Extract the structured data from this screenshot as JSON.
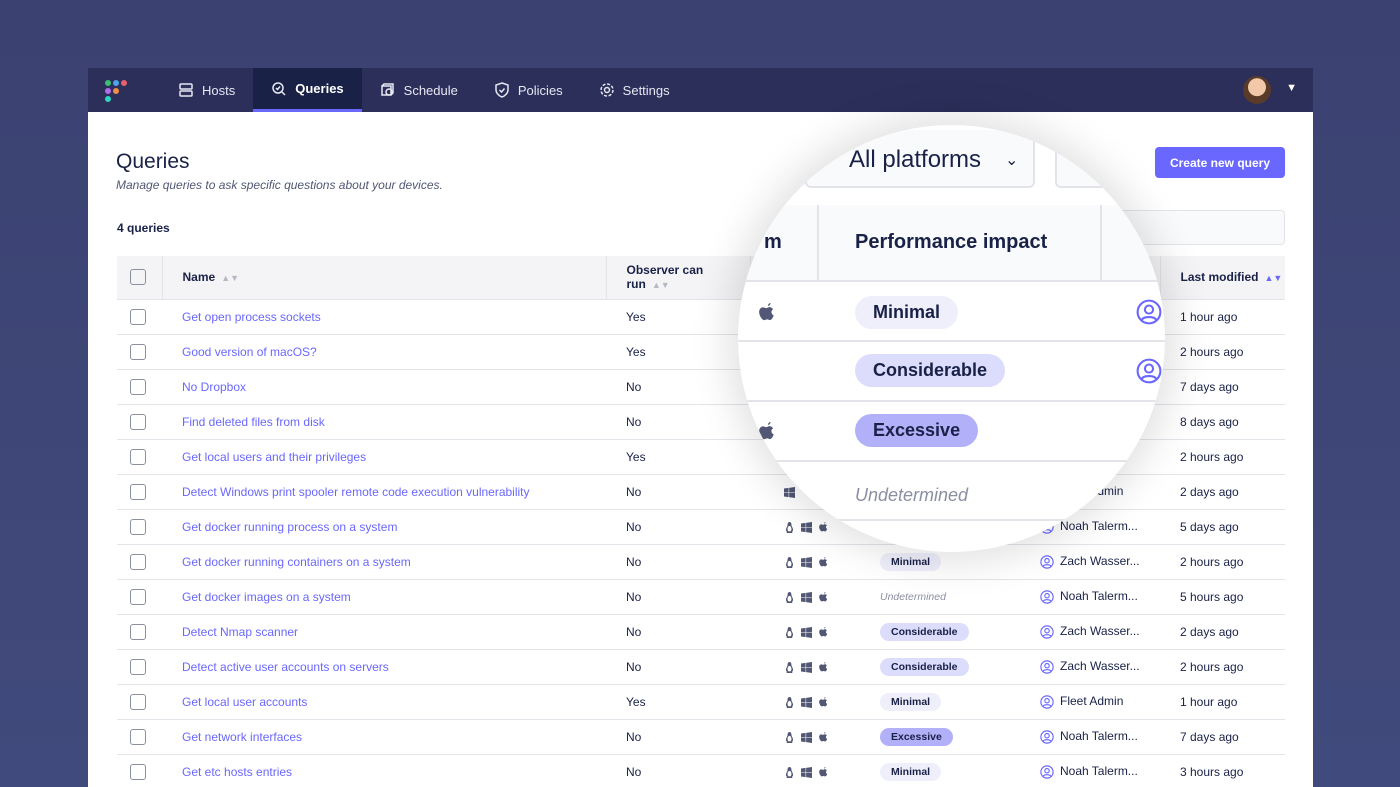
{
  "nav": {
    "tabs": [
      {
        "label": "Hosts",
        "icon": "hosts-icon"
      },
      {
        "label": "Queries",
        "icon": "queries-icon",
        "active": true
      },
      {
        "label": "Schedule",
        "icon": "schedule-icon"
      },
      {
        "label": "Policies",
        "icon": "policies-icon"
      },
      {
        "label": "Settings",
        "icon": "gear-icon"
      }
    ]
  },
  "page": {
    "title": "Queries",
    "subtitle": "Manage queries to ask specific questions about your devices.",
    "count": "4 queries",
    "create_label": "Create new query",
    "platform_filter": "All platforms"
  },
  "columns": {
    "name": "Name",
    "observer": "Observer can run",
    "impact": "Performance impact",
    "modified": "Last modified",
    "platform_partial": "m"
  },
  "colors": {
    "accent": "#6a67fe",
    "nav": "#2b2f5a",
    "text": "#192147",
    "minimal": "#efeffc",
    "considerable": "#dcdcfc",
    "excessive": "#b2b0f8"
  },
  "rows": [
    {
      "name": "Get open process sockets",
      "observer": "Yes",
      "platforms": [
        "macos"
      ],
      "impact": "Minimal",
      "author": "",
      "modified": "1 hour ago"
    },
    {
      "name": "Good version of macOS?",
      "observer": "Yes",
      "platforms": [],
      "impact": "Considerable",
      "author": "",
      "modified": "2 hours ago"
    },
    {
      "name": "No Dropbox",
      "observer": "No",
      "platforms": [],
      "impact": "Excessive",
      "author": "",
      "modified": "7 days ago"
    },
    {
      "name": "Find deleted files from disk",
      "observer": "No",
      "platforms": [
        "macos"
      ],
      "impact": "Undetermined",
      "author": "",
      "modified": "8 days ago"
    },
    {
      "name": "Get local users and their privileges",
      "observer": "Yes",
      "platforms": [],
      "impact": "",
      "author": "",
      "modified": "2 hours ago"
    },
    {
      "name": "Detect Windows print spooler remote code execution vulnerability",
      "observer": "No",
      "platforms": [
        "windows"
      ],
      "impact": "",
      "author": "Fleet Admin",
      "modified": "2 days ago"
    },
    {
      "name": "Get docker running process on a system",
      "observer": "No",
      "platforms": [
        "linux",
        "windows",
        "macos"
      ],
      "impact": "",
      "author": "Noah Talerm...",
      "modified": "5 days ago"
    },
    {
      "name": "Get docker running containers on a system",
      "observer": "No",
      "platforms": [
        "linux",
        "windows",
        "macos"
      ],
      "impact": "Minimal",
      "author": "Zach Wasser...",
      "modified": "2 hours ago"
    },
    {
      "name": "Get docker images on a system",
      "observer": "No",
      "platforms": [
        "linux",
        "windows",
        "macos"
      ],
      "impact": "Undetermined",
      "author": "Noah Talerm...",
      "modified": "5 hours ago"
    },
    {
      "name": "Detect Nmap scanner",
      "observer": "No",
      "platforms": [
        "linux",
        "windows",
        "macos"
      ],
      "impact": "Considerable",
      "author": "Zach Wasser...",
      "modified": "2 days ago"
    },
    {
      "name": "Detect active user accounts on servers",
      "observer": "No",
      "platforms": [
        "linux",
        "windows",
        "macos"
      ],
      "impact": "Considerable",
      "author": "Zach Wasser...",
      "modified": "2 hours ago"
    },
    {
      "name": "Get local user accounts",
      "observer": "Yes",
      "platforms": [
        "linux",
        "windows",
        "macos"
      ],
      "impact": "Minimal",
      "author": "Fleet Admin",
      "modified": "1 hour ago"
    },
    {
      "name": "Get network interfaces",
      "observer": "No",
      "platforms": [
        "linux",
        "windows",
        "macos"
      ],
      "impact": "Excessive",
      "author": "Noah Talerm...",
      "modified": "7 days ago"
    },
    {
      "name": "Get etc hosts entries",
      "observer": "No",
      "platforms": [
        "linux",
        "windows",
        "macos"
      ],
      "impact": "Minimal",
      "author": "Noah Talerm...",
      "modified": "3 hours ago"
    }
  ]
}
